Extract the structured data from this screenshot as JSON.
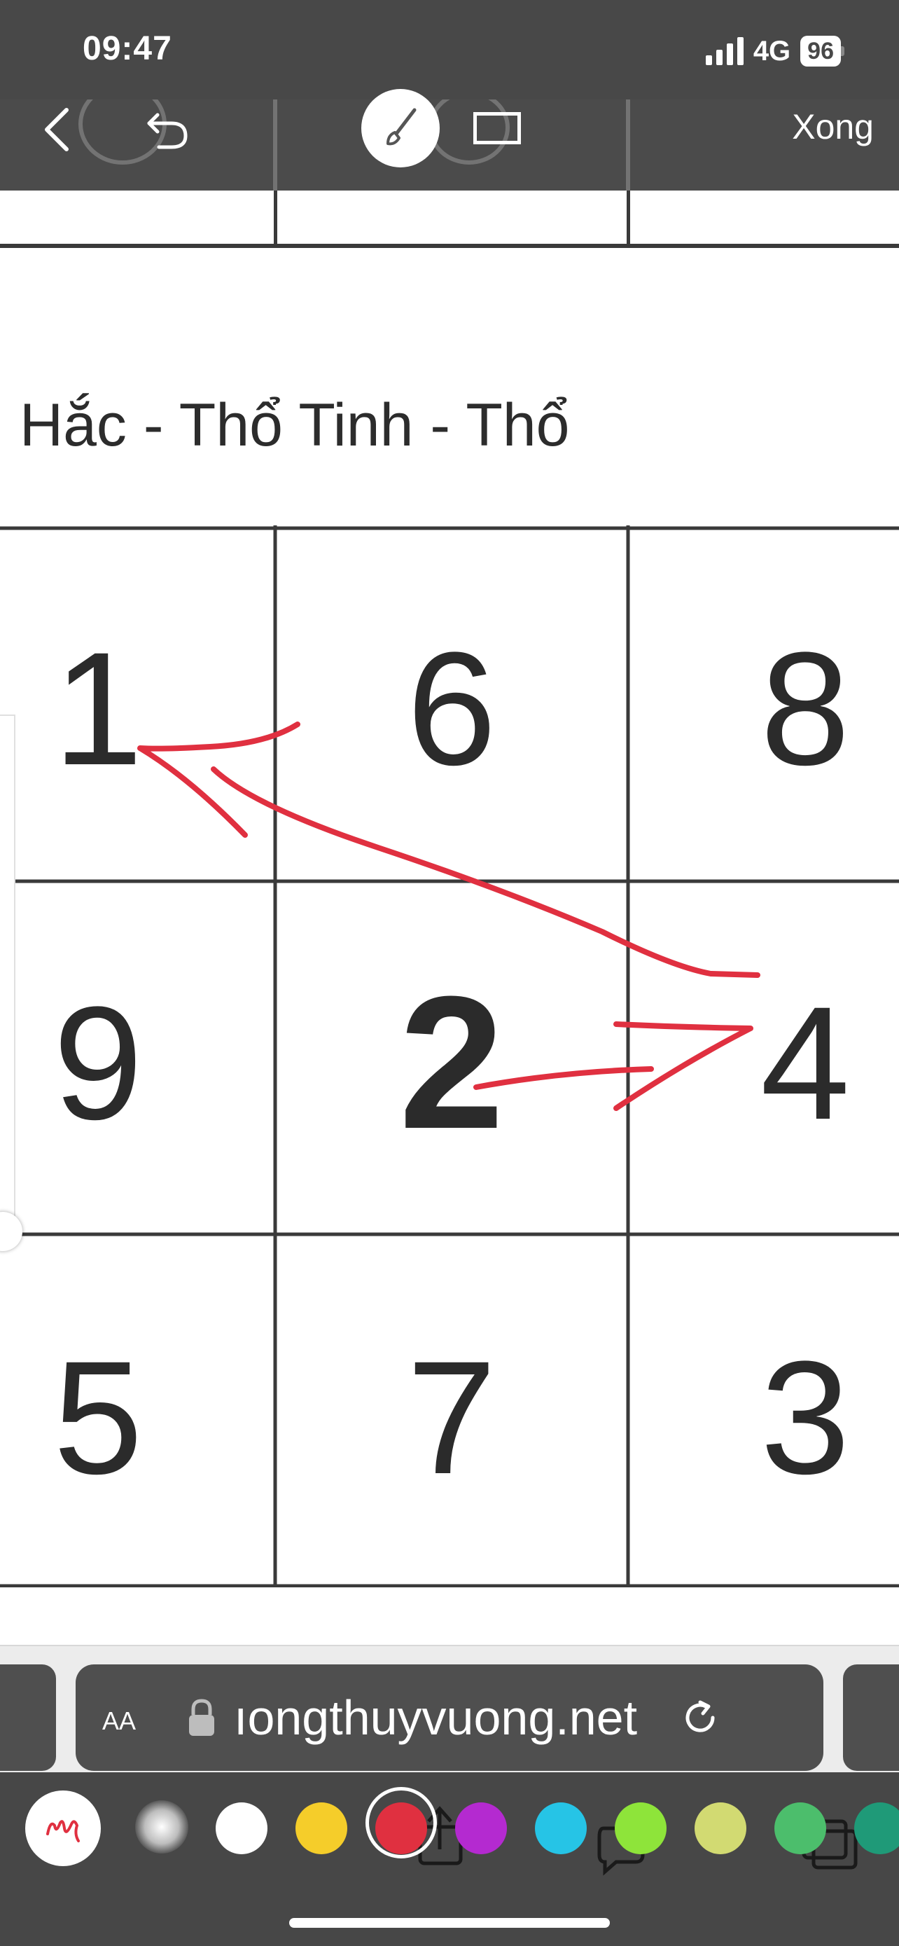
{
  "status": {
    "time": "09:47",
    "network": "4G",
    "battery": "96"
  },
  "toolbar": {
    "done_label": "Xong"
  },
  "page": {
    "heading": "Hắc - Thổ Tinh - Thổ",
    "grid": [
      [
        "1",
        "6",
        "8"
      ],
      [
        "9",
        "2",
        "4"
      ],
      [
        "5",
        "7",
        "3"
      ]
    ]
  },
  "browser": {
    "aa_label": "AA",
    "url": "ıongthuyvuong.net"
  },
  "palette": {
    "selected": "red",
    "colors": [
      {
        "name": "white",
        "hex": "#ffffff"
      },
      {
        "name": "yellow",
        "hex": "#f5cd2a"
      },
      {
        "name": "red",
        "hex": "#e03040"
      },
      {
        "name": "purple",
        "hex": "#b42ad0"
      },
      {
        "name": "cyan",
        "hex": "#26c4e6"
      },
      {
        "name": "lime",
        "hex": "#8ee43a"
      },
      {
        "name": "khaki",
        "hex": "#d2da72"
      },
      {
        "name": "green",
        "hex": "#4cbe6c"
      },
      {
        "name": "teal",
        "hex": "#1f9a78"
      }
    ]
  },
  "ink_color": "#e03040"
}
